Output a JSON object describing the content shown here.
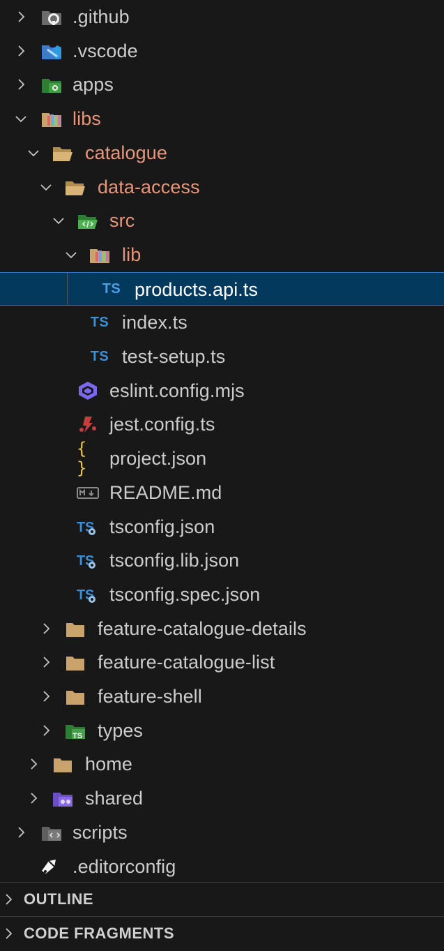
{
  "explorer": {
    "items": [
      {
        "label": ".github"
      },
      {
        "label": ".vscode"
      },
      {
        "label": "apps"
      },
      {
        "label": "libs"
      },
      {
        "label": "catalogue"
      },
      {
        "label": "data-access"
      },
      {
        "label": "src"
      },
      {
        "label": "lib"
      },
      {
        "label": "products.api.ts",
        "badge": "TS"
      },
      {
        "label": "index.ts",
        "badge": "TS"
      },
      {
        "label": "test-setup.ts",
        "badge": "TS"
      },
      {
        "label": "eslint.config.mjs"
      },
      {
        "label": "jest.config.ts"
      },
      {
        "label": "project.json",
        "badge": "{ }"
      },
      {
        "label": "README.md"
      },
      {
        "label": "tsconfig.json"
      },
      {
        "label": "tsconfig.lib.json"
      },
      {
        "label": "tsconfig.spec.json"
      },
      {
        "label": "feature-catalogue-details"
      },
      {
        "label": "feature-catalogue-list"
      },
      {
        "label": "feature-shell"
      },
      {
        "label": "types"
      },
      {
        "label": "home"
      },
      {
        "label": "shared"
      },
      {
        "label": "scripts"
      },
      {
        "label": ".editorconfig"
      }
    ]
  },
  "sections": {
    "outline": "OUTLINE",
    "code_fragments": "CODE FRAGMENTS"
  },
  "colors": {
    "background": "#181818",
    "selected_background": "#04395e",
    "selected_border": "#2b79d3",
    "open_folder_label": "#e8957a",
    "text": "#cccccc",
    "ts_badge": "#3b8fd6"
  }
}
